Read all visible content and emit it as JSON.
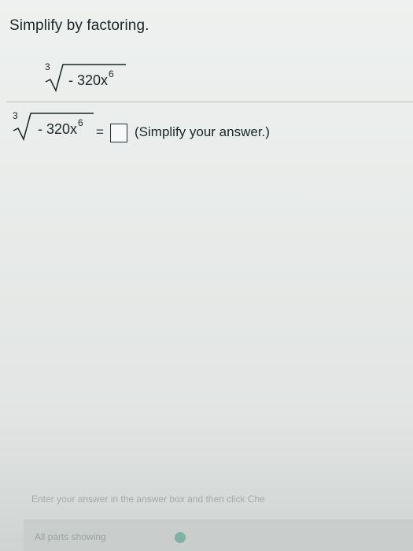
{
  "problem": {
    "instruction": "Simplify by factoring.",
    "expression": {
      "index": "3",
      "radicand": "- 320x",
      "exponent": "6"
    }
  },
  "answer_row": {
    "expression": {
      "index": "3",
      "radicand": "- 320x",
      "exponent": "6"
    },
    "equals": "=",
    "answer_value": "",
    "hint": "(Simplify your answer.)"
  },
  "footer": {
    "help_text": "Enter your answer in the answer box and then click Che",
    "status_text": "All parts showing"
  }
}
